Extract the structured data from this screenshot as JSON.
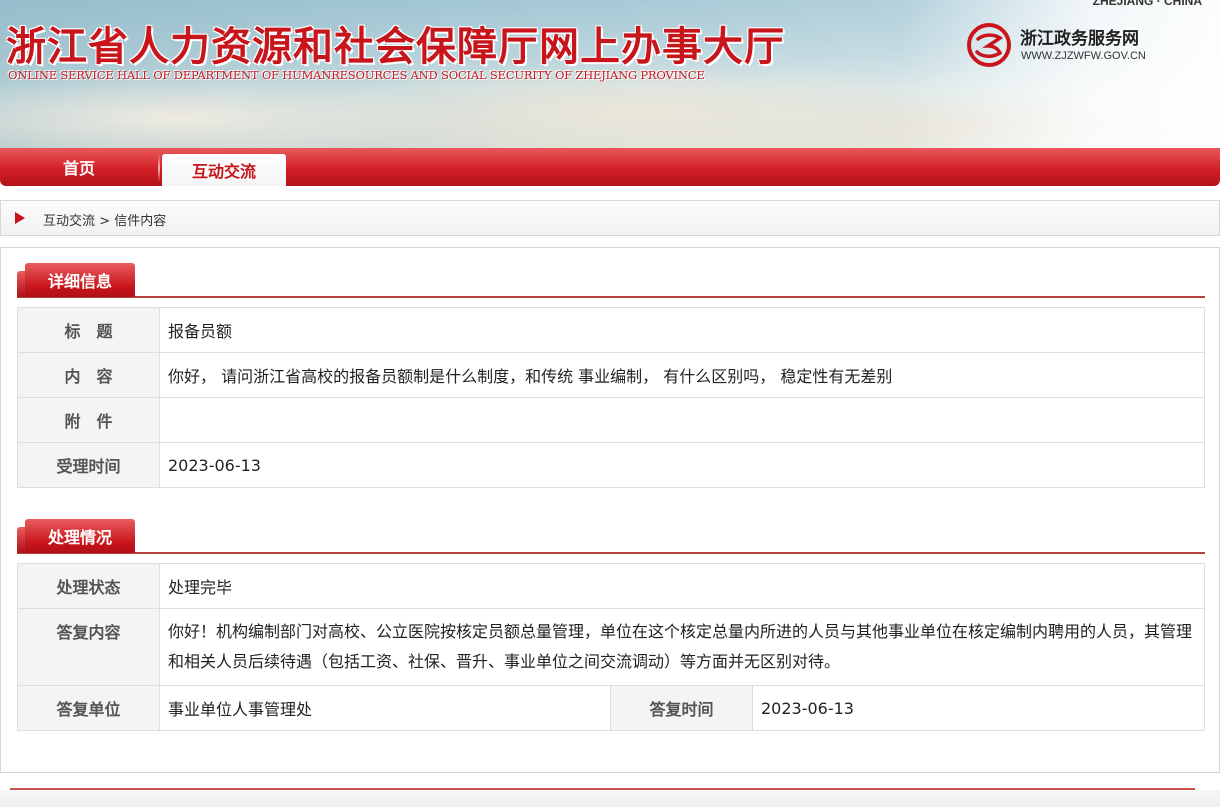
{
  "header": {
    "title": "浙江省人力资源和社会保障厅网上办事大厅",
    "subtitle": "ONLINE SERVICE HALL OF DEPARTMENT OF HUMANRESOURCES AND SOCIAL SECURITY OF ZHEJIANG PROVINCE",
    "top_right_cut": "ZHEJIANG · CHINA",
    "gov_portal_name": "浙江政务服务网",
    "gov_portal_url": "WWW.ZJZWFW.GOV.CN",
    "colors": {
      "brand_red": "#c8151b"
    }
  },
  "nav": {
    "items": [
      {
        "label": "首页",
        "active": false
      },
      {
        "label": "互动交流",
        "active": true
      }
    ]
  },
  "breadcrumb": {
    "items": [
      "互动交流",
      "信件内容"
    ],
    "separator": ">"
  },
  "detail_section": {
    "heading": "详细信息",
    "rows": [
      {
        "label": "标　题",
        "value": "报备员额"
      },
      {
        "label": "内　容",
        "value": "你好， 请问浙江省高校的报备员额制是什么制度，和传统 事业编制， 有什么区别吗， 稳定性有无差别"
      },
      {
        "label": "附　件",
        "value": ""
      },
      {
        "label": "受理时间",
        "value": "2023-06-13"
      }
    ]
  },
  "handling_section": {
    "heading": "处理情况",
    "status_label": "处理状态",
    "status_value": "处理完毕",
    "reply_label": "答复内容",
    "reply_value": "你好！机构编制部门对高校、公立医院按核定员额总量管理，单位在这个核定总量内所进的人员与其他事业单位在核定编制内聘用的人员，其管理和相关人员后续待遇（包括工资、社保、晋升、事业单位之间交流调动）等方面并无区别对待。",
    "unit_label": "答复单位",
    "unit_value": "事业单位人事管理处",
    "time_label": "答复时间",
    "time_value": "2023-06-13"
  }
}
